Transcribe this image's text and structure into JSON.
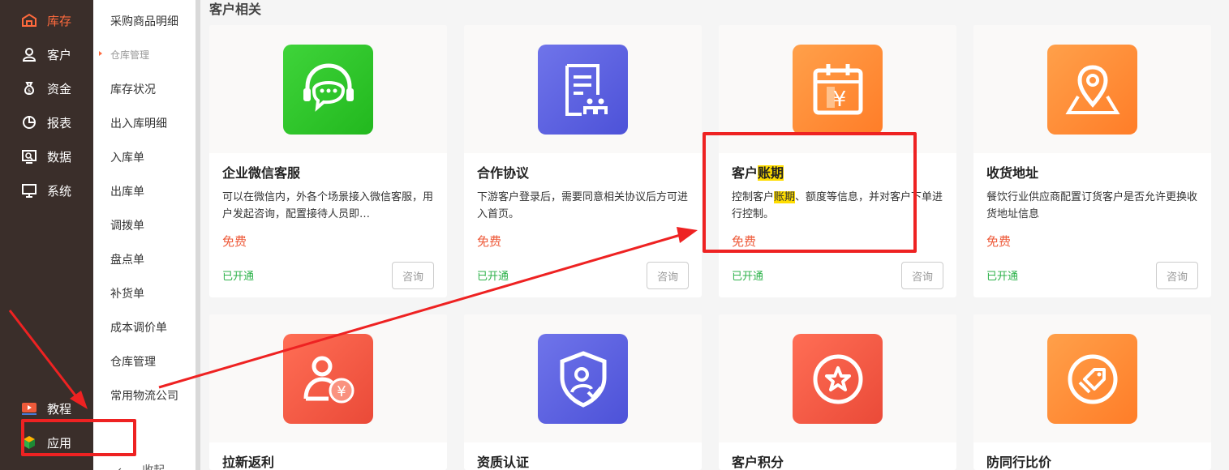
{
  "sidebar": {
    "items": [
      {
        "label": "库存",
        "icon": "warehouse-icon",
        "active": true
      },
      {
        "label": "客户",
        "icon": "user-icon"
      },
      {
        "label": "资金",
        "icon": "money-bag-icon"
      },
      {
        "label": "报表",
        "icon": "pie-chart-icon"
      },
      {
        "label": "数据",
        "icon": "data-screen-icon"
      },
      {
        "label": "系统",
        "icon": "monitor-icon"
      }
    ],
    "bottom": [
      {
        "label": "教程",
        "icon": "video-play-icon"
      },
      {
        "label": "应用",
        "icon": "app-cube-icon"
      }
    ],
    "accent": "#ff6a3d"
  },
  "submenu": {
    "items": [
      "采购商品明细",
      "库存状况",
      "出入库明细",
      "入库单",
      "出库单",
      "调拨单",
      "盘点单",
      "补货单",
      "成本调价单",
      "仓库管理",
      "常用物流公司"
    ],
    "group": "仓库管理",
    "collapse": "收起"
  },
  "main": {
    "section_title": "客户相关",
    "cards": [
      {
        "name": "企业微信客服",
        "desc": "可以在微信内，外各个场景接入微信客服，用户发起咨询，配置接待人员即…",
        "price": "免费",
        "status": "已开通",
        "button": "咨询",
        "tile_color": "#2fc52a",
        "icon": "headset-chat-icon"
      },
      {
        "name": "合作协议",
        "desc": "下游客户登录后，需要同意相关协议后方可进入首页。",
        "price": "免费",
        "status": "已开通",
        "button": "咨询",
        "tile_color": "#5a5fe0",
        "icon": "agreement-doc-icon"
      },
      {
        "name_pre": "客户",
        "name_hl": "账期",
        "desc_pre": "控制客户",
        "desc_hl": "账期",
        "desc_post": "、额度等信息，并对客户下单进行控制。",
        "price": "免费",
        "status": "已开通",
        "button": "咨询",
        "tile_color": "#ff8a3a",
        "icon": "calendar-yen-icon"
      },
      {
        "name": "收货地址",
        "desc": "餐饮行业供应商配置订货客户是否允许更换收货地址信息",
        "price": "免费",
        "status": "已开通",
        "button": "咨询",
        "tile_color": "#ff8a3a",
        "icon": "map-pin-icon"
      },
      {
        "name": "拉新返利",
        "tile_color": "#f25a46",
        "icon": "user-rebate-icon"
      },
      {
        "name": "资质认证",
        "tile_color": "#5a5fe0",
        "icon": "shield-user-icon"
      },
      {
        "name": "客户积分",
        "tile_color": "#f25a46",
        "icon": "star-badge-icon"
      },
      {
        "name": "防同行比价",
        "tile_color": "#ff8a3a",
        "icon": "price-tag-icon"
      }
    ]
  },
  "annotation_color": "#ee2222"
}
